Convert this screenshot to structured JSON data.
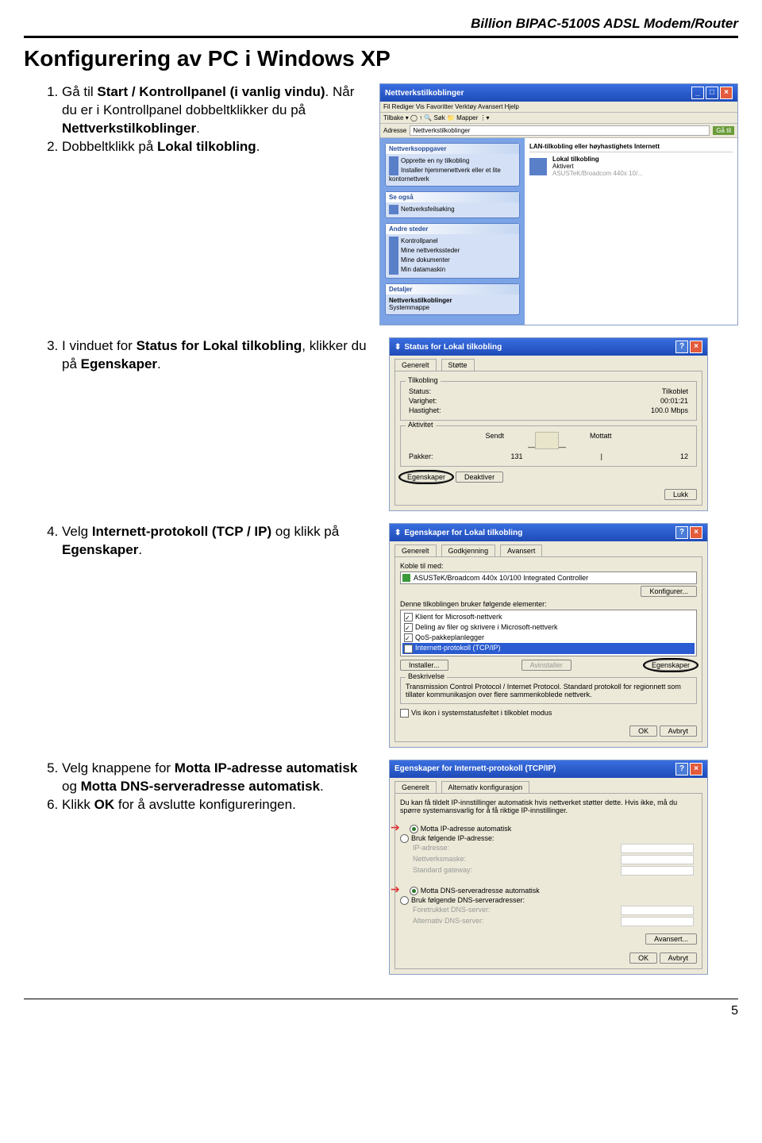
{
  "header": "Billion BIPAC-5100S ADSL Modem/Router",
  "title": "Konfigurering av PC i Windows XP",
  "steps": {
    "s1a": "Gå til ",
    "s1b": "Start / Kontrollpanel (i vanlig vindu)",
    "s1c": ". Når du er i Kontrollpanel dobbeltklikker du på ",
    "s1d": "Nettverkstilkoblinger",
    "s1e": ".",
    "s2a": "Dobbeltklikk på ",
    "s2b": "Lokal tilkobling",
    "s2c": ".",
    "s3a": "I vinduet for ",
    "s3b": "Status for Lokal tilkobling",
    "s3c": ", klikker du på ",
    "s3d": "Egenskaper",
    "s3e": ".",
    "s4a": "Velg ",
    "s4b": "Internett-protokoll (TCP / IP)",
    "s4c": " og klikk på ",
    "s4d": "Egenskaper",
    "s4e": ".",
    "s5a": "Velg knappene for ",
    "s5b": "Motta IP-adresse automatisk",
    "s5c": " og ",
    "s5d": "Motta DNS-serveradresse automatisk",
    "s5e": ".",
    "s6a": "Klikk ",
    "s6b": "OK",
    "s6c": " for å avslutte konfigureringen."
  },
  "shot1": {
    "title": "Nettverkstilkoblinger",
    "menu": "Fil  Rediger  Vis  Favoritter  Verktøy  Avansert  Hjelp",
    "toolbar": "Tilbake ▾  ◯  ↑   🔍 Søk   📁 Mapper   ⋮▾",
    "addrLbl": "Adresse",
    "addr": "Nettverkstilkoblinger",
    "go": "Gå til",
    "tasksHd": "Nettverksoppgaver",
    "task1": "Opprette en ny tilkobling",
    "task2": "Installer hjemmenettverk eller et lite kontornettverk",
    "seeAlsoHd": "Se også",
    "see1": "Nettverksfeilsøking",
    "placesHd": "Andre steder",
    "place1": "Kontrollpanel",
    "place2": "Mine nettverkssteder",
    "place3": "Mine dokumenter",
    "place4": "Min datamaskin",
    "detailsHd": "Detaljer",
    "detail1": "Nettverkstilkoblinger",
    "detail2": "Systemmappe",
    "rightHd": "LAN-tilkobling eller høyhastighets Internett",
    "rightName": "Lokal tilkobling",
    "rightSub1": "Aktivert",
    "rightSub2": "ASUSTeK/Broadcom 440x 10/..."
  },
  "shot2": {
    "title": "Status for Lokal tilkobling",
    "tab1": "Generelt",
    "tab2": "Støtte",
    "gbConn": "Tilkobling",
    "statusLbl": "Status:",
    "statusVal": "Tilkoblet",
    "durLbl": "Varighet:",
    "durVal": "00:01:21",
    "spdLbl": "Hastighet:",
    "spdVal": "100.0 Mbps",
    "gbAct": "Aktivitet",
    "sent": "Sendt",
    "recv": "Mottatt",
    "pktLbl": "Pakker:",
    "pktSent": "131",
    "pktRecv": "12",
    "btnProps": "Egenskaper",
    "btnDeact": "Deaktiver",
    "btnClose": "Lukk"
  },
  "shot3": {
    "title": "Egenskaper for Lokal tilkobling",
    "tab1": "Generelt",
    "tab2": "Godkjenning",
    "tab3": "Avansert",
    "connLbl": "Koble til med:",
    "adapter": "ASUSTeK/Broadcom 440x 10/100 Integrated Controller",
    "btnCfg": "Konfigurer...",
    "usesLbl": "Denne tilkoblingen bruker følgende elementer:",
    "item1": "Klient for Microsoft-nettverk",
    "item2": "Deling av filer og skrivere i Microsoft-nettverk",
    "item3": "QoS-pakkeplanlegger",
    "item4": "Internett-protokoll (TCP/IP)",
    "btnInstall": "Installer...",
    "btnUninstall": "Avinstaller",
    "btnProps": "Egenskaper",
    "descHd": "Beskrivelse",
    "desc": "Transmission Control Protocol / Internet Protocol. Standard protokoll for regionnett som tillater kommunikasjon over flere sammenkoblede nettverk.",
    "showIcon": "Vis ikon i systemstatusfeltet i tilkoblet modus",
    "ok": "OK",
    "cancel": "Avbryt"
  },
  "shot4": {
    "title": "Egenskaper for Internett-protokoll (TCP/IP)",
    "tab1": "Generelt",
    "tab2": "Alternativ konfigurasjon",
    "intro": "Du kan få tildelt IP-innstillinger automatisk hvis nettverket støtter dette. Hvis ikke, må du spørre systemansvarlig for å få riktige IP-innstillinger.",
    "r1": "Motta IP-adresse automatisk",
    "r2": "Bruk følgende IP-adresse:",
    "ipLbl": "IP-adresse:",
    "maskLbl": "Nettverksmaske:",
    "gwLbl": "Standard gateway:",
    "r3": "Motta DNS-serveradresse automatisk",
    "r4": "Bruk følgende DNS-serveradresser:",
    "dns1Lbl": "Foretrukket DNS-server:",
    "dns2Lbl": "Alternativ DNS-server:",
    "btnAdv": "Avansert...",
    "ok": "OK",
    "cancel": "Avbryt"
  },
  "pageNum": "5"
}
